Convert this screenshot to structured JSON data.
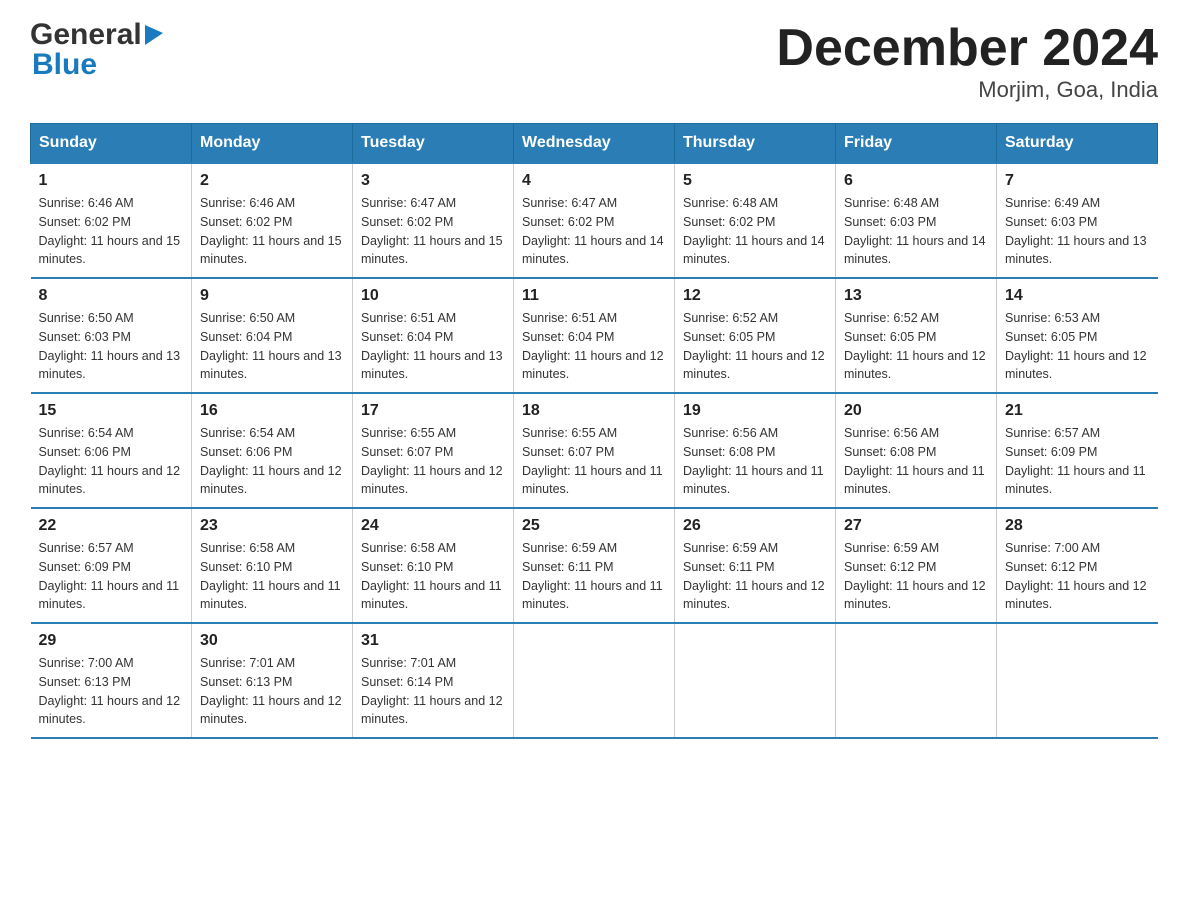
{
  "header": {
    "logo_line1": "General",
    "logo_line2": "Blue",
    "title": "December 2024",
    "subtitle": "Morjim, Goa, India"
  },
  "days_of_week": [
    "Sunday",
    "Monday",
    "Tuesday",
    "Wednesday",
    "Thursday",
    "Friday",
    "Saturday"
  ],
  "weeks": [
    [
      {
        "day": "1",
        "sunrise": "6:46 AM",
        "sunset": "6:02 PM",
        "daylight": "11 hours and 15 minutes."
      },
      {
        "day": "2",
        "sunrise": "6:46 AM",
        "sunset": "6:02 PM",
        "daylight": "11 hours and 15 minutes."
      },
      {
        "day": "3",
        "sunrise": "6:47 AM",
        "sunset": "6:02 PM",
        "daylight": "11 hours and 15 minutes."
      },
      {
        "day": "4",
        "sunrise": "6:47 AM",
        "sunset": "6:02 PM",
        "daylight": "11 hours and 14 minutes."
      },
      {
        "day": "5",
        "sunrise": "6:48 AM",
        "sunset": "6:02 PM",
        "daylight": "11 hours and 14 minutes."
      },
      {
        "day": "6",
        "sunrise": "6:48 AM",
        "sunset": "6:03 PM",
        "daylight": "11 hours and 14 minutes."
      },
      {
        "day": "7",
        "sunrise": "6:49 AM",
        "sunset": "6:03 PM",
        "daylight": "11 hours and 13 minutes."
      }
    ],
    [
      {
        "day": "8",
        "sunrise": "6:50 AM",
        "sunset": "6:03 PM",
        "daylight": "11 hours and 13 minutes."
      },
      {
        "day": "9",
        "sunrise": "6:50 AM",
        "sunset": "6:04 PM",
        "daylight": "11 hours and 13 minutes."
      },
      {
        "day": "10",
        "sunrise": "6:51 AM",
        "sunset": "6:04 PM",
        "daylight": "11 hours and 13 minutes."
      },
      {
        "day": "11",
        "sunrise": "6:51 AM",
        "sunset": "6:04 PM",
        "daylight": "11 hours and 12 minutes."
      },
      {
        "day": "12",
        "sunrise": "6:52 AM",
        "sunset": "6:05 PM",
        "daylight": "11 hours and 12 minutes."
      },
      {
        "day": "13",
        "sunrise": "6:52 AM",
        "sunset": "6:05 PM",
        "daylight": "11 hours and 12 minutes."
      },
      {
        "day": "14",
        "sunrise": "6:53 AM",
        "sunset": "6:05 PM",
        "daylight": "11 hours and 12 minutes."
      }
    ],
    [
      {
        "day": "15",
        "sunrise": "6:54 AM",
        "sunset": "6:06 PM",
        "daylight": "11 hours and 12 minutes."
      },
      {
        "day": "16",
        "sunrise": "6:54 AM",
        "sunset": "6:06 PM",
        "daylight": "11 hours and 12 minutes."
      },
      {
        "day": "17",
        "sunrise": "6:55 AM",
        "sunset": "6:07 PM",
        "daylight": "11 hours and 12 minutes."
      },
      {
        "day": "18",
        "sunrise": "6:55 AM",
        "sunset": "6:07 PM",
        "daylight": "11 hours and 11 minutes."
      },
      {
        "day": "19",
        "sunrise": "6:56 AM",
        "sunset": "6:08 PM",
        "daylight": "11 hours and 11 minutes."
      },
      {
        "day": "20",
        "sunrise": "6:56 AM",
        "sunset": "6:08 PM",
        "daylight": "11 hours and 11 minutes."
      },
      {
        "day": "21",
        "sunrise": "6:57 AM",
        "sunset": "6:09 PM",
        "daylight": "11 hours and 11 minutes."
      }
    ],
    [
      {
        "day": "22",
        "sunrise": "6:57 AM",
        "sunset": "6:09 PM",
        "daylight": "11 hours and 11 minutes."
      },
      {
        "day": "23",
        "sunrise": "6:58 AM",
        "sunset": "6:10 PM",
        "daylight": "11 hours and 11 minutes."
      },
      {
        "day": "24",
        "sunrise": "6:58 AM",
        "sunset": "6:10 PM",
        "daylight": "11 hours and 11 minutes."
      },
      {
        "day": "25",
        "sunrise": "6:59 AM",
        "sunset": "6:11 PM",
        "daylight": "11 hours and 11 minutes."
      },
      {
        "day": "26",
        "sunrise": "6:59 AM",
        "sunset": "6:11 PM",
        "daylight": "11 hours and 12 minutes."
      },
      {
        "day": "27",
        "sunrise": "6:59 AM",
        "sunset": "6:12 PM",
        "daylight": "11 hours and 12 minutes."
      },
      {
        "day": "28",
        "sunrise": "7:00 AM",
        "sunset": "6:12 PM",
        "daylight": "11 hours and 12 minutes."
      }
    ],
    [
      {
        "day": "29",
        "sunrise": "7:00 AM",
        "sunset": "6:13 PM",
        "daylight": "11 hours and 12 minutes."
      },
      {
        "day": "30",
        "sunrise": "7:01 AM",
        "sunset": "6:13 PM",
        "daylight": "11 hours and 12 minutes."
      },
      {
        "day": "31",
        "sunrise": "7:01 AM",
        "sunset": "6:14 PM",
        "daylight": "11 hours and 12 minutes."
      },
      null,
      null,
      null,
      null
    ]
  ]
}
